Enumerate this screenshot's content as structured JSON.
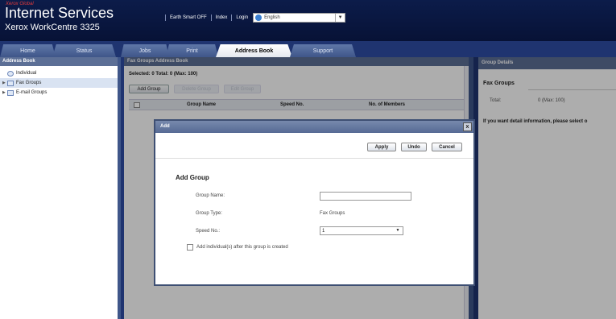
{
  "brand": {
    "small": "Xerox Global",
    "title": "Internet Services",
    "model": "Xerox WorkCentre 3325"
  },
  "header_links": [
    "Earth Smart OFF",
    "Index",
    "Login"
  ],
  "language": {
    "selected": "English",
    "icon": "globe-icon"
  },
  "tabs": [
    "Home",
    "Status",
    "Jobs",
    "Print",
    "Address Book",
    "Support"
  ],
  "left_panel": {
    "title": "Address Book",
    "items": [
      {
        "label": "Individual",
        "icon": "person-icon"
      },
      {
        "label": "Fax Groups",
        "icon": "folder-icon"
      },
      {
        "label": "E-mail Groups",
        "icon": "folder-icon"
      }
    ]
  },
  "middle_panel": {
    "title": "Fax Groups Address Book",
    "selected_line": "Selected: 0   Total: 0 (Max: 100)",
    "buttons": [
      "Add Group",
      "Delete Group",
      "Edit Group"
    ],
    "columns": [
      "Group Name",
      "Speed No.",
      "No. of Members"
    ]
  },
  "right_panel": {
    "title": "Group Details",
    "section": "Fax Groups",
    "total_label": "Total:",
    "total_value": "0 (Max: 100)",
    "info": "If you want detail information, please select o"
  },
  "dialog": {
    "title": "Add",
    "close": "x",
    "buttons": {
      "apply": "Apply",
      "undo": "Undo",
      "cancel": "Cancel"
    },
    "section": "Add Group",
    "group_name_label": "Group Name:",
    "group_name_value": "",
    "group_type_label": "Group Type:",
    "group_type_value": "Fax Groups",
    "speed_label": "Speed No.:",
    "speed_value": "1",
    "checkbox_label": "Add individual(s) after this group is created"
  },
  "colors": {
    "header": "#0c1c4a",
    "panel_header": "#5c6f96",
    "frame": "#3f5689"
  }
}
